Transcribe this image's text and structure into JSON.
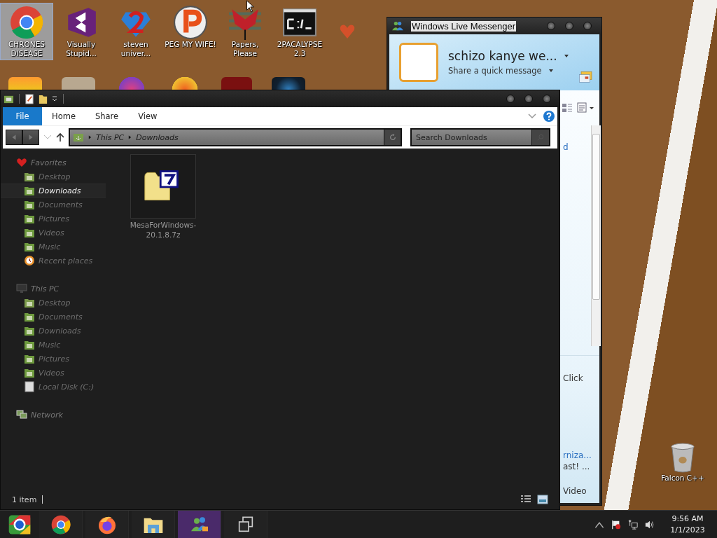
{
  "desktop": {
    "icons": [
      {
        "label": "CHRONES DISEASE",
        "kind": "chrome",
        "selected": true
      },
      {
        "label": "Visually Stupid...",
        "kind": "vs",
        "selected": false
      },
      {
        "label": "steven univer...",
        "kind": "gem",
        "selected": false
      },
      {
        "label": "PEG MY WIFE!",
        "kind": "peggle",
        "selected": false
      },
      {
        "label": "Papers, Please",
        "kind": "papers",
        "selected": false
      },
      {
        "label": "2PACALYPSE 2.3",
        "kind": "console",
        "selected": false
      }
    ],
    "recycle_bin": {
      "label": "Falcon C++"
    }
  },
  "messenger": {
    "title": "Windows Live Messenger",
    "display_name": "schizo kanye we...",
    "personal_message": "Share a quick message",
    "fragments": [
      {
        "text": "d",
        "kind": "link"
      },
      {
        "text": "Click",
        "kind": "plain"
      },
      {
        "text": "rniza...",
        "kind": "link"
      },
      {
        "text": "ast! ...",
        "kind": "plain"
      },
      {
        "text": "Video",
        "kind": "plain"
      }
    ]
  },
  "explorer": {
    "ribbon_tabs": [
      {
        "label": "File",
        "selected": true
      },
      {
        "label": "Home",
        "selected": false
      },
      {
        "label": "Share",
        "selected": false
      },
      {
        "label": "View",
        "selected": false
      }
    ],
    "address": [
      "This PC",
      "Downloads"
    ],
    "search": {
      "placeholder": "Search Downloads"
    },
    "nav": [
      {
        "label": "Favorites",
        "kind": "favorites",
        "children": [
          {
            "label": "Desktop",
            "kind": "desktop",
            "selected": false
          },
          {
            "label": "Downloads",
            "kind": "downloads",
            "selected": true
          },
          {
            "label": "Documents",
            "kind": "documents",
            "selected": false
          },
          {
            "label": "Pictures",
            "kind": "pictures",
            "selected": false
          },
          {
            "label": "Videos",
            "kind": "videos",
            "selected": false
          },
          {
            "label": "Music",
            "kind": "music",
            "selected": false
          },
          {
            "label": "Recent places",
            "kind": "recent",
            "selected": false
          }
        ]
      },
      {
        "label": "This PC",
        "kind": "pc",
        "children": [
          {
            "label": "Desktop",
            "kind": "desktop",
            "selected": false
          },
          {
            "label": "Documents",
            "kind": "documents",
            "selected": false
          },
          {
            "label": "Downloads",
            "kind": "downloads",
            "selected": false
          },
          {
            "label": "Music",
            "kind": "music",
            "selected": false
          },
          {
            "label": "Pictures",
            "kind": "pictures",
            "selected": false
          },
          {
            "label": "Videos",
            "kind": "videos",
            "selected": false
          },
          {
            "label": "Local Disk (C:)",
            "kind": "disk",
            "selected": false
          }
        ]
      },
      {
        "label": "Network",
        "kind": "network"
      }
    ],
    "files": [
      {
        "name": "MesaForWindows-20.1.8.7z",
        "kind": "archive"
      }
    ],
    "status": "1 item"
  },
  "taskbar": {
    "apps": [
      {
        "kind": "chrome",
        "selected": false
      },
      {
        "kind": "firefox",
        "selected": false
      },
      {
        "kind": "folder",
        "selected": false
      },
      {
        "kind": "messenger",
        "selected": true
      },
      {
        "kind": "taskview",
        "selected": false
      }
    ],
    "clock": {
      "time": "9:56 AM",
      "date": "1/1/2023"
    }
  }
}
